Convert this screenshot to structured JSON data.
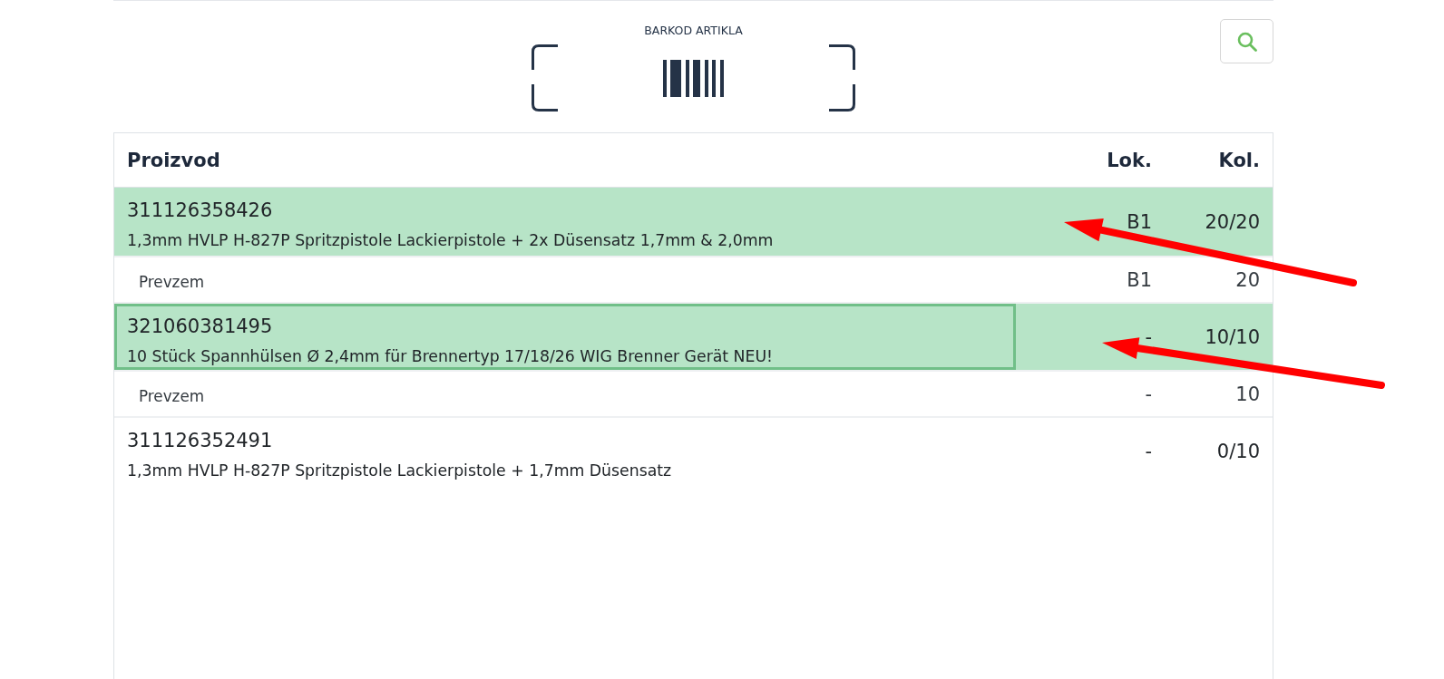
{
  "scanner": {
    "label": "BARKOD ARTIKLA"
  },
  "table": {
    "columns": [
      {
        "label": "Proizvod"
      },
      {
        "label": "Lok."
      },
      {
        "label": "Kol."
      }
    ],
    "rows": [
      {
        "code": "311126358426",
        "name": "1,3mm HVLP H-827P Spritzpistole Lackierpistole + 2x Düsensatz 1,7mm & 2,0mm",
        "location": "B1",
        "quantity": "20/20",
        "complete": true,
        "focused": false,
        "details": [
          {
            "label": "Prevzem",
            "location": "B1",
            "quantity": "20"
          }
        ]
      },
      {
        "code": "321060381495",
        "name": "10 Stück Spannhülsen Ø 2,4mm für Brennertyp 17/18/26 WIG Brenner Gerät NEU!",
        "location": "-",
        "quantity": "10/10",
        "complete": true,
        "focused": true,
        "details": [
          {
            "label": "Prevzem",
            "location": "-",
            "quantity": "10"
          }
        ]
      },
      {
        "code": "311126352491",
        "name": "1,3mm HVLP H-827P Spritzpistole Lackierpistole + 1,7mm Düsensatz",
        "location": "-",
        "quantity": "0/10",
        "complete": false,
        "focused": false
      }
    ]
  },
  "annotations": [
    {
      "kind": "arrow"
    },
    {
      "kind": "arrow"
    }
  ]
}
